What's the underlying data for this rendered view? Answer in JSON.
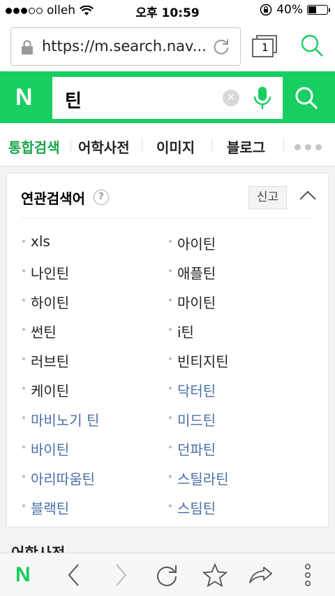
{
  "status_bar": {
    "carrier": "olleh",
    "time": "오후 10:59",
    "battery": "40%"
  },
  "address_bar": {
    "url": "https://m.search.nav...",
    "tab_count": "1"
  },
  "search": {
    "logo": "N",
    "query": "틴"
  },
  "tabs": [
    {
      "label": "통합검색"
    },
    {
      "label": "어학사전"
    },
    {
      "label": "이미지"
    },
    {
      "label": "블로그"
    }
  ],
  "related": {
    "title": "연관검색어",
    "help": "?",
    "report": "신고",
    "left": [
      "xls",
      "나인틴",
      "하이틴",
      "썬틴",
      "러브틴",
      "케이틴",
      "마비노기 틴",
      "바이틴",
      "아리따움틴",
      "블랙틴"
    ],
    "right": [
      "아이틴",
      "애플틴",
      "마이틴",
      "i틴",
      "빈티지틴",
      "닥터틴",
      "미드틴",
      "던파틴",
      "스틸라틴",
      "스팀틴"
    ]
  },
  "next_section": {
    "title": "어학사전"
  },
  "toolbar": {
    "logo": "N"
  },
  "colors": {
    "brand_green": "#19ce60",
    "active_tab": "#19a54a",
    "visited_link": "#4a6fa5"
  }
}
